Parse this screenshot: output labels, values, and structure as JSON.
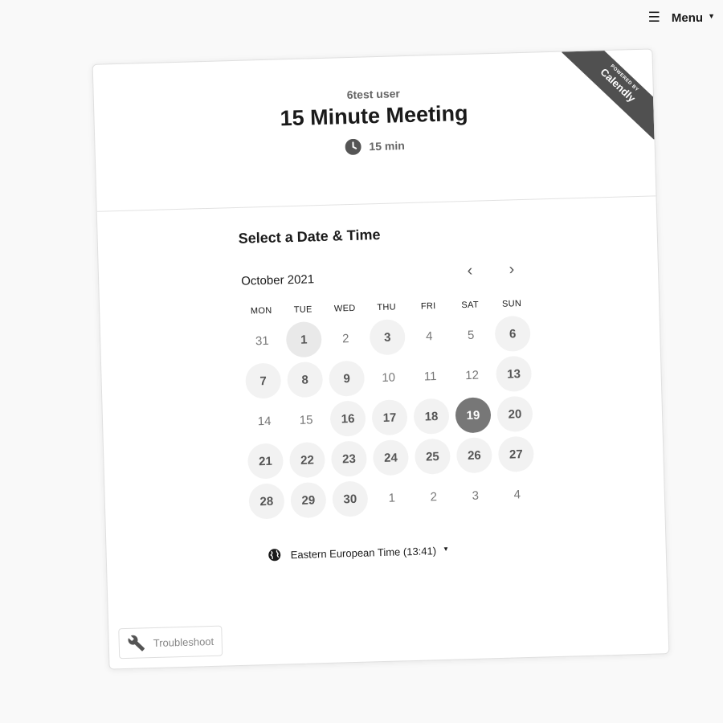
{
  "topbar": {
    "menu_label": "Menu"
  },
  "ribbon": {
    "powered_by": "POWERED BY",
    "brand": "Calendly"
  },
  "event": {
    "organizer": "6test user",
    "title": "15 Minute Meeting",
    "duration": "15 min"
  },
  "calendar": {
    "section_title": "Select a Date & Time",
    "month_label": "October 2021",
    "prev_label": "‹",
    "next_label": "›",
    "weekdays": [
      "MON",
      "TUE",
      "WED",
      "THU",
      "FRI",
      "SAT",
      "SUN"
    ],
    "weeks": [
      [
        {
          "d": "31",
          "s": "off"
        },
        {
          "d": "1",
          "s": "today"
        },
        {
          "d": "2",
          "s": "off"
        },
        {
          "d": "3",
          "s": "avail"
        },
        {
          "d": "4",
          "s": "off"
        },
        {
          "d": "5",
          "s": "off"
        },
        {
          "d": "6",
          "s": "avail"
        }
      ],
      [
        {
          "d": "7",
          "s": "avail"
        },
        {
          "d": "8",
          "s": "avail"
        },
        {
          "d": "9",
          "s": "avail"
        },
        {
          "d": "10",
          "s": "off"
        },
        {
          "d": "11",
          "s": "off"
        },
        {
          "d": "12",
          "s": "off"
        },
        {
          "d": "13",
          "s": "avail"
        }
      ],
      [
        {
          "d": "14",
          "s": "off"
        },
        {
          "d": "15",
          "s": "off"
        },
        {
          "d": "16",
          "s": "avail"
        },
        {
          "d": "17",
          "s": "avail"
        },
        {
          "d": "18",
          "s": "avail"
        },
        {
          "d": "19",
          "s": "sel"
        },
        {
          "d": "20",
          "s": "avail"
        }
      ],
      [
        {
          "d": "21",
          "s": "avail"
        },
        {
          "d": "22",
          "s": "avail"
        },
        {
          "d": "23",
          "s": "avail"
        },
        {
          "d": "24",
          "s": "avail"
        },
        {
          "d": "25",
          "s": "avail"
        },
        {
          "d": "26",
          "s": "avail"
        },
        {
          "d": "27",
          "s": "avail"
        }
      ],
      [
        {
          "d": "28",
          "s": "avail"
        },
        {
          "d": "29",
          "s": "avail"
        },
        {
          "d": "30",
          "s": "avail"
        },
        {
          "d": "1",
          "s": "off"
        },
        {
          "d": "2",
          "s": "off"
        },
        {
          "d": "3",
          "s": "off"
        },
        {
          "d": "4",
          "s": "off"
        }
      ]
    ],
    "selected_date": "19"
  },
  "timezone": {
    "label": "Eastern European Time (13:41)"
  },
  "footer": {
    "troubleshoot_label": "Troubleshoot"
  },
  "colors": {
    "selected": "#777777",
    "available_bg": "#f2f2f2",
    "ribbon": "#505050"
  }
}
